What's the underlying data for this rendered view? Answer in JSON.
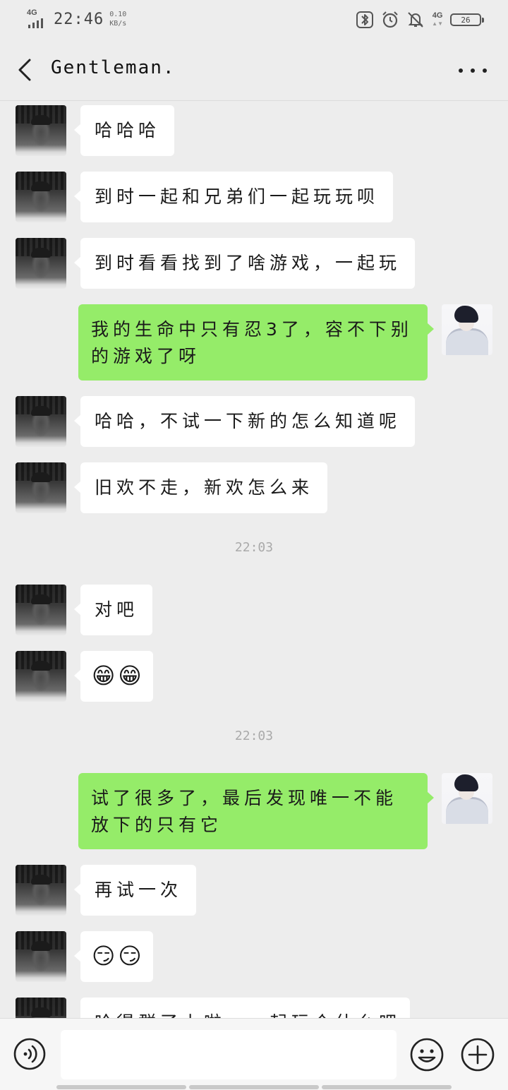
{
  "status_bar": {
    "network_label": "4G",
    "time": "22:46",
    "speed_value": "0.10",
    "speed_unit": "KB/s",
    "network_label_right": "4G",
    "battery": "26"
  },
  "header": {
    "title": "Gentleman."
  },
  "timestamps": [
    "22:03",
    "22:03"
  ],
  "messages": [
    {
      "side": "left",
      "text": "哈哈哈"
    },
    {
      "side": "left",
      "text": "到时一起和兄弟们一起玩玩呗"
    },
    {
      "side": "left",
      "text": "到时看看找到了啥游戏，一起玩"
    },
    {
      "side": "right",
      "text": "我的生命中只有忍3了，容不下别的游戏了呀"
    },
    {
      "side": "left",
      "text": "哈哈，不试一下新的怎么知道呢"
    },
    {
      "side": "left",
      "text": "旧欢不走，新欢怎么来"
    },
    {
      "side": "left",
      "text": "对吧"
    },
    {
      "side": "left",
      "emoji": [
        "😁",
        "😁"
      ]
    },
    {
      "side": "right",
      "text": "试了很多了，最后发现唯一不能放下的只有它"
    },
    {
      "side": "left",
      "text": "再试一次"
    },
    {
      "side": "left",
      "emoji": [
        "😏",
        "😏"
      ]
    },
    {
      "side": "left",
      "text": "哈得群了上啦，一起玩个什么吧"
    }
  ],
  "icons": {
    "back": "chevron-left-icon",
    "more": "more-dots-icon",
    "voice": "voice-icon",
    "emoji": "smiley-icon",
    "plus": "plus-circle-icon"
  },
  "colors": {
    "background": "#ededed",
    "bubble_self": "#95ec69",
    "bubble_other": "#ffffff"
  }
}
